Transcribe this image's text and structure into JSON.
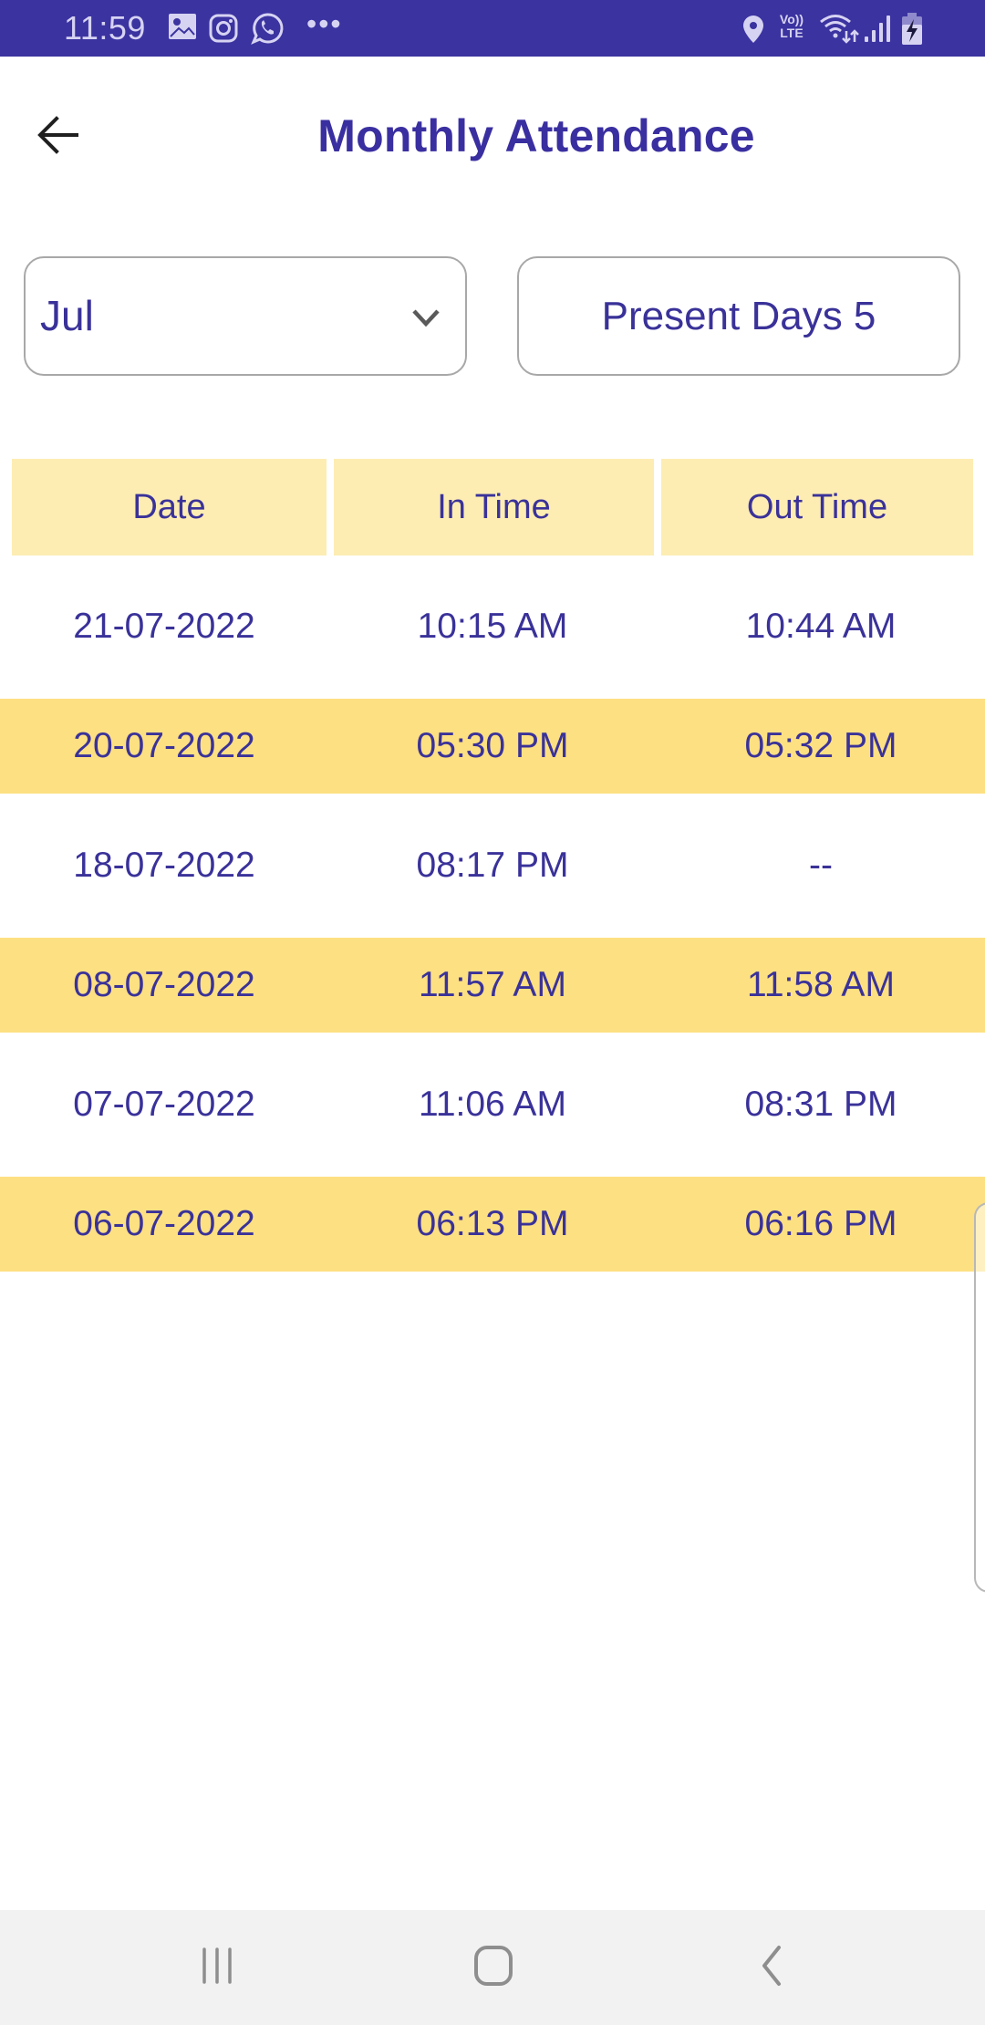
{
  "status_bar": {
    "time": "11:59",
    "left_icons": [
      "gallery-icon",
      "instagram-icon",
      "whatsapp-icon",
      "more-notifications-icon"
    ],
    "more_label": "•••",
    "right_icons": [
      "location-icon",
      "volte-icon",
      "wifi-icon",
      "signal-icon",
      "battery-charging-icon"
    ],
    "volte_top": "Vo))",
    "volte_bottom": "LTE"
  },
  "app_bar": {
    "title": "Monthly Attendance",
    "back_icon": "arrow-left-icon"
  },
  "filters": {
    "month_selected": "Jul",
    "present_days_label": "Present Days 5"
  },
  "table": {
    "columns": [
      "Date",
      "In Time",
      "Out Time"
    ],
    "rows": [
      {
        "date": "21-07-2022",
        "in_time": "10:15 AM",
        "out_time": "10:44 AM",
        "highlighted": false
      },
      {
        "date": "20-07-2022",
        "in_time": "05:30 PM",
        "out_time": "05:32 PM",
        "highlighted": true
      },
      {
        "date": "18-07-2022",
        "in_time": "08:17 PM",
        "out_time": "--",
        "highlighted": false
      },
      {
        "date": "08-07-2022",
        "in_time": "11:57 AM",
        "out_time": "11:58 AM",
        "highlighted": true
      },
      {
        "date": "07-07-2022",
        "in_time": "11:06 AM",
        "out_time": "08:31 PM",
        "highlighted": false
      },
      {
        "date": "06-07-2022",
        "in_time": "06:13 PM",
        "out_time": "06:16 PM",
        "highlighted": true
      }
    ]
  },
  "colors": {
    "status_bar": "#3b33a0",
    "primary_text": "#3a3299",
    "header_cell": "#fdedb3",
    "highlight_row": "#fde082",
    "nav_bar": "#f2f2f2"
  },
  "nav_bar": {
    "buttons": [
      "recents-icon",
      "home-icon",
      "back-icon"
    ]
  }
}
